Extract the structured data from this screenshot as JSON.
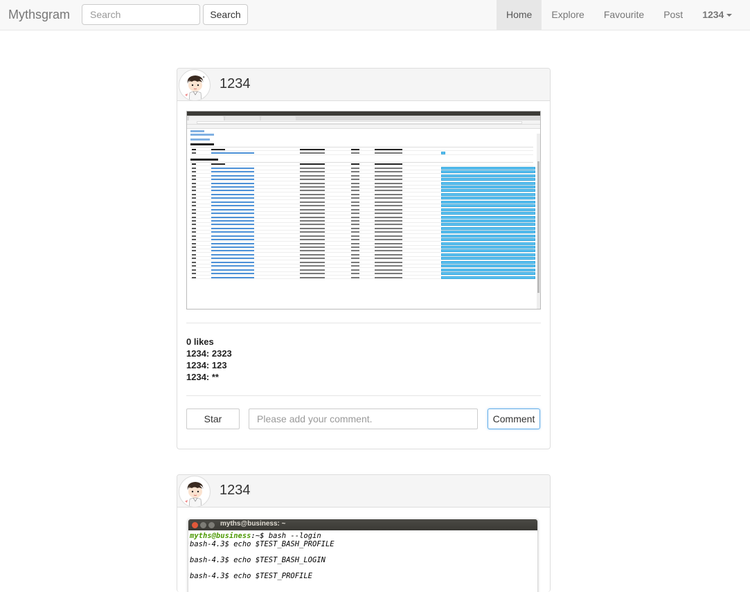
{
  "navbar": {
    "brand": "Mythsgram",
    "search_placeholder": "Search",
    "search_button": "Search",
    "links": [
      {
        "label": "Home",
        "active": true
      },
      {
        "label": "Explore",
        "active": false
      },
      {
        "label": "Favourite",
        "active": false
      },
      {
        "label": "Post",
        "active": false
      }
    ],
    "user": "1234"
  },
  "posts": [
    {
      "author": "1234",
      "image": "spark-jobs-screenshot",
      "likes": "0 likes",
      "comments": [
        "1234: 2323",
        "1234: 123",
        "1234: **"
      ],
      "star_button": "Star",
      "comment_placeholder": "Please add your comment.",
      "comment_button": "Comment"
    },
    {
      "author": "1234",
      "image": "terminal-screenshot",
      "terminal": {
        "title": "myths@business: ~",
        "prompt_user": "myths@business",
        "prompt_path": ":~$ ",
        "first_command": "bash --login",
        "lines": [
          "bash-4.3$ echo $TEST_BASH_PROFILE",
          "",
          "bash-4.3$ echo $TEST_BASH_LOGIN",
          "",
          "bash-4.3$ echo $TEST_PROFILE"
        ]
      }
    }
  ],
  "colors": {
    "navbar_bg": "#f8f8f8",
    "active_nav_bg": "#e7e7e7",
    "panel_head_bg": "#f5f5f5",
    "focus_border": "#66afe9",
    "progress_bar": "#5bc0f0"
  }
}
